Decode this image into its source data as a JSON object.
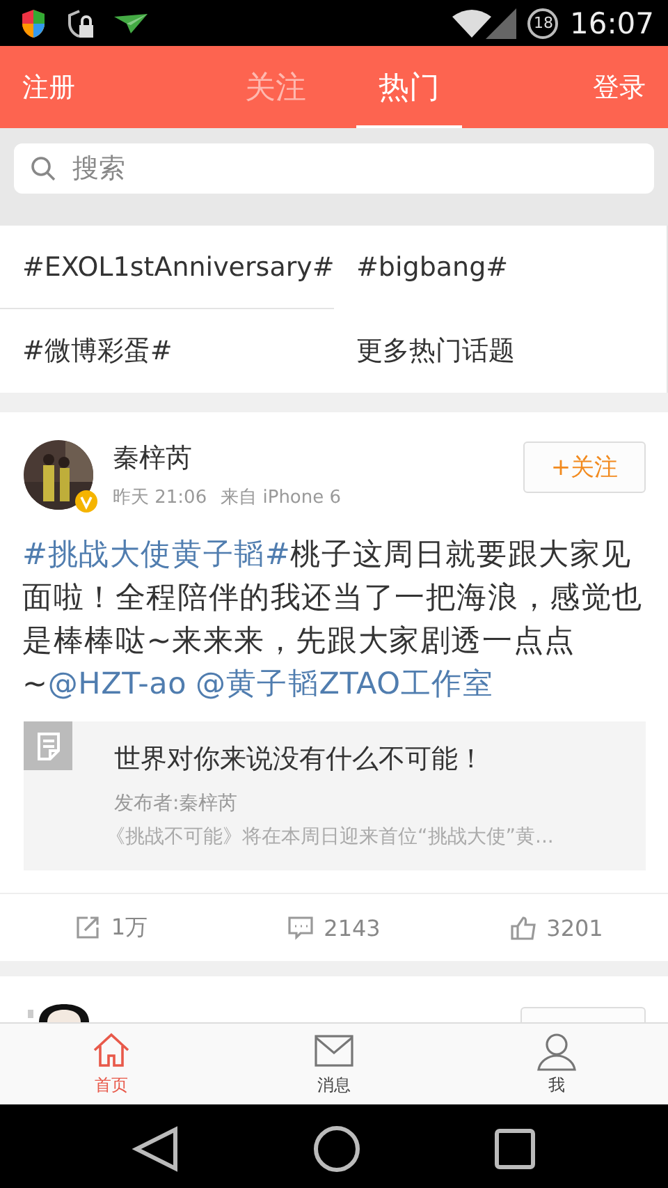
{
  "status_bar": {
    "badge": "18",
    "time": "16:07"
  },
  "header": {
    "left": "注册",
    "right": "登录",
    "tabs": [
      {
        "label": "关注",
        "selected": false
      },
      {
        "label": "热门",
        "selected": true
      }
    ]
  },
  "search": {
    "placeholder": "搜索"
  },
  "topics": [
    "#EXOL1stAnniversary#",
    "#bigbang#",
    "#微博彩蛋#",
    "更多热门话题"
  ],
  "post": {
    "author": "秦梓芮",
    "verified": true,
    "time": "昨天 21:06",
    "source": "来自 iPhone 6",
    "follow": "+关注",
    "body": [
      {
        "kind": "topic",
        "text": "#挑战大使黄子韬#"
      },
      {
        "kind": "text",
        "text": "桃子这周日就要跟大家见面啦！全程陪伴的我还当了一把海浪，感觉也是棒棒哒~来来来，先跟大家剧透一点点~"
      },
      {
        "kind": "mention",
        "text": "@HZT-ao"
      },
      {
        "kind": "mention",
        "text": "@黄子韬ZTAO工作室"
      }
    ],
    "card": {
      "title": "世界对你来说没有什么不可能！",
      "publisher": "发布者:秦梓芮",
      "summary": "《挑战不可能》将在本周日迎来首位“挑战大使”黄..."
    },
    "actions": [
      {
        "kind": "repost",
        "count": "1万"
      },
      {
        "kind": "comment",
        "count": "2143"
      },
      {
        "kind": "like",
        "count": "3201"
      }
    ]
  },
  "tab_bar": [
    {
      "kind": "home",
      "label": "首页",
      "selected": true
    },
    {
      "kind": "message",
      "label": "消息",
      "selected": false
    },
    {
      "kind": "profile",
      "label": "我",
      "selected": false
    }
  ]
}
